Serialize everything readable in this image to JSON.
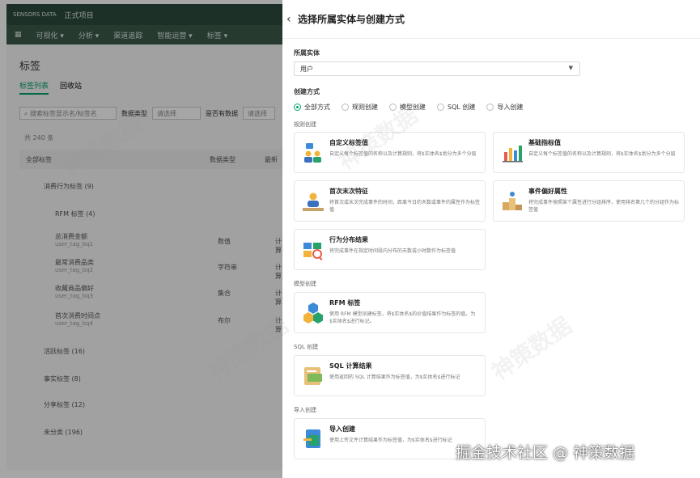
{
  "background_app": {
    "logo_text": "SENSORS DATA",
    "project": "正式项目",
    "nav": [
      "可视化 ▾",
      "分析 ▾",
      "渠道追踪",
      "智能运营 ▾",
      "标签 ▾"
    ],
    "page_title": "标签",
    "tabs": [
      "标签列表",
      "回收站"
    ],
    "filter_search_placeholder": "搜索标签显示名/标签名",
    "filter_type_label": "数据类型",
    "filter_type_value": "请选择",
    "filter_has_data_label": "是否有数据",
    "filter_has_data_value": "请选择",
    "count_text": "共 240 条",
    "columns": [
      "全部标签",
      "数据类型",
      "最新"
    ],
    "rows": [
      {
        "name": "消费行为标签 (9)",
        "sub": "",
        "type": "",
        "status": ""
      },
      {
        "name": "RFM 标签 (4)",
        "sub": "",
        "type": "",
        "status": ""
      },
      {
        "name": "总消费金额",
        "sub": "user_tag_bq1",
        "type": "数值",
        "status": "计算"
      },
      {
        "name": "最常消费品类",
        "sub": "user_tag_bq2",
        "type": "字符串",
        "status": "计算"
      },
      {
        "name": "收藏商品偏好",
        "sub": "user_tag_bq3",
        "type": "集合",
        "status": "计算"
      },
      {
        "name": "首次消费时间点",
        "sub": "user_tag_bq4",
        "type": "布尔",
        "status": "计算"
      },
      {
        "name": "活跃标签 (16)",
        "sub": "",
        "type": "",
        "status": ""
      },
      {
        "name": "事实标签 (8)",
        "sub": "",
        "type": "",
        "status": ""
      },
      {
        "name": "分享标签 (12)",
        "sub": "",
        "type": "",
        "status": ""
      },
      {
        "name": "未分类 (196)",
        "sub": "",
        "type": "",
        "status": ""
      }
    ]
  },
  "drawer": {
    "title": "选择所属实体与创建方式",
    "entity_label": "所属实体",
    "entity_value": "用户",
    "method_label": "创建方式",
    "methods": [
      {
        "label": "全部方式",
        "checked": true
      },
      {
        "label": "规则创建",
        "checked": false
      },
      {
        "label": "模型创建",
        "checked": false
      },
      {
        "label": "SQL 创建",
        "checked": false
      },
      {
        "label": "导入创建",
        "checked": false
      }
    ],
    "sections": {
      "rule": "规则创建",
      "model": "模型创建",
      "sql": "SQL 创建",
      "import": "导入创建"
    },
    "cards": [
      {
        "title": "自定义标签值",
        "desc": "自定义每个标签值的名称以及计算规则，将$实体名$划分为多个分层",
        "icon": "custom-tag-icon"
      },
      {
        "title": "基础指标值",
        "desc": "自定义每个标签值的名称以及计算规则，将$实体名$划分为多个分层",
        "icon": "bar-chart-icon"
      },
      {
        "title": "首次末次特征",
        "desc": "将首次或末次完成事件的时间，距离今日的天数或事件的属性作为标签值",
        "icon": "first-last-icon"
      },
      {
        "title": "事件偏好属性",
        "desc": "将完成事件按照某个属性进行分组排序，使用排名第几个的分组作为标签值",
        "icon": "podium-icon"
      },
      {
        "title": "行为分布结果",
        "desc": "将完成事件在指定时间段内分布的天数或小时数作为标签值",
        "icon": "distribution-icon"
      },
      {
        "title": "RFM 标签",
        "desc": "使用 RFM 模型创建标签，将$实体名$的价值结果作为标签的值，为$实体名$进行标记。",
        "icon": "rfm-icon"
      },
      {
        "title": "SQL 计算结果",
        "desc": "使用返回的 SQL 计算结果作为标签值，为$实体名$进行标记",
        "icon": "sql-icon"
      },
      {
        "title": "导入创建",
        "desc": "使用上传文件计算结果作为标签值，为$实体名$进行标记",
        "icon": "import-icon"
      }
    ]
  },
  "footer_watermark": "掘金技术社区 @ 神策数据",
  "watermark_text": "神策数据"
}
